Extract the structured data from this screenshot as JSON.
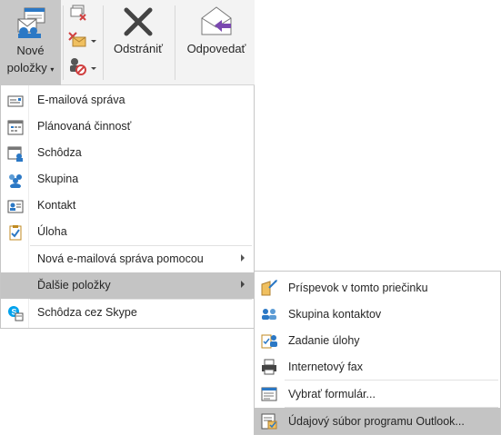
{
  "ribbon": {
    "new_items_line1": "Nové",
    "new_items_line2": "položky",
    "delete_label": "Odstrániť",
    "reply_label": "Odpovedať"
  },
  "menu": {
    "items": [
      {
        "label": "E-mailová správa",
        "icon": "email-icon"
      },
      {
        "label": "Plánovaná činnosť",
        "icon": "calendar-icon"
      },
      {
        "label": "Schôdza",
        "icon": "meeting-icon"
      },
      {
        "label": "Skupina",
        "icon": "group-icon"
      },
      {
        "label": "Kontakt",
        "icon": "contact-icon"
      },
      {
        "label": "Úloha",
        "icon": "task-icon"
      },
      {
        "label": "Nová e-mailová správa pomocou",
        "icon": ""
      },
      {
        "label": "Ďalšie položky",
        "icon": ""
      },
      {
        "label": "Schôdza cez Skype",
        "icon": "skype-meeting-icon"
      }
    ]
  },
  "submenu": {
    "items": [
      {
        "label": "Príspevok v tomto priečinku",
        "icon": "post-icon"
      },
      {
        "label": "Skupina kontaktov",
        "icon": "contact-group-icon"
      },
      {
        "label": "Zadanie úlohy",
        "icon": "task-request-icon"
      },
      {
        "label": "Internetový fax",
        "icon": "fax-icon"
      },
      {
        "label": "Vybrať formulár...",
        "icon": "form-icon"
      },
      {
        "label": "Údajový súbor programu Outlook...",
        "icon": "outlook-data-file-icon"
      }
    ]
  },
  "colors": {
    "highlight": "#c4c4c4",
    "ribbon_bg": "#f3f3f3",
    "accent_blue": "#2b78c5",
    "accent_purple": "#7a48b0"
  }
}
